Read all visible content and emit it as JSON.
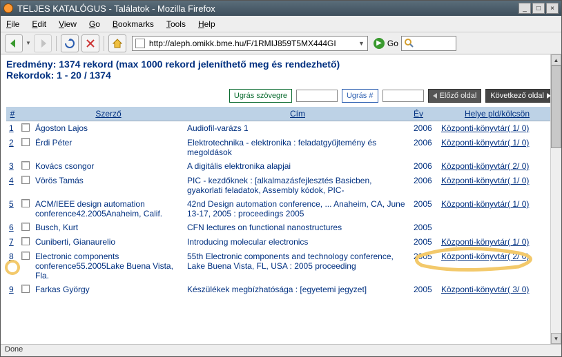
{
  "window": {
    "title": "TELJES KATALÓGUS - Találatok - Mozilla Firefox"
  },
  "menu": {
    "file": "File",
    "edit": "Edit",
    "view": "View",
    "go": "Go",
    "bookmarks": "Bookmarks",
    "tools": "Tools",
    "help": "Help"
  },
  "toolbar": {
    "url": "http://aleph.omikk.bme.hu/F/1RMIJ859T5MX444GI",
    "go": "Go"
  },
  "summary": {
    "result_line": "Eredmény: 1374 rekord (max 1000 rekord jeleníthető meg és rendezhető)",
    "records_line": "Rekordok: 1 - 20 / 1374"
  },
  "controls": {
    "jump_text": "Ugrás szövegre",
    "jump_num": "Ugrás #",
    "prev": "Előző oldal",
    "next": "Következő oldal"
  },
  "headers": {
    "num": "#",
    "author": "Szerző",
    "title": "Cím",
    "year": "Év",
    "loc": "Helye pld/kölcsön"
  },
  "rows": [
    {
      "n": "1",
      "author": "Ágoston Lajos",
      "title": "Audiofil-varázs 1",
      "year": "2006",
      "loc": "Központi-könyvtár( 1/ 0)"
    },
    {
      "n": "2",
      "author": "Érdi Péter",
      "title": "Elektrotechnika - elektronika : feladatgyűjtemény és megoldások",
      "year": "2006",
      "loc": "Központi-könyvtár( 1/ 0)"
    },
    {
      "n": "3",
      "author": "Kovács csongor",
      "title": "A digitális elektronika alapjai",
      "year": "2006",
      "loc": "Központi-könyvtár( 2/ 0)"
    },
    {
      "n": "4",
      "author": "Vörös Tamás",
      "title": "PIC - kezdőknek : [alkalmazásfejlesztés Basicben, gyakorlati feladatok, Assembly kódok, PIC-",
      "year": "2006",
      "loc": "Központi-könyvtár( 1/ 0)"
    },
    {
      "n": "5",
      "author": "ACM/IEEE design automation conference42.2005Anaheim, Calif.",
      "title": "42nd Design automation conference, ... Anaheim, CA, June 13-17, 2005 : proceedings 2005",
      "year": "2005",
      "loc": "Központi-könyvtár( 1/ 0)"
    },
    {
      "n": "6",
      "author": "Busch, Kurt",
      "title": "CFN lectures on functional nanostructures",
      "year": "2005",
      "loc": ""
    },
    {
      "n": "7",
      "author": "Cuniberti, Gianaurelio",
      "title": "Introducing molecular electronics",
      "year": "2005",
      "loc": "Központi-könyvtár( 1/ 0)"
    },
    {
      "n": "8",
      "author": "Electronic components conference55.2005Lake Buena Vista, Fla.",
      "title": "55th Electronic components and technology conference, Lake Buena Vista, FL, USA : 2005 proceeding",
      "year": "2005",
      "loc": "Központi-könyvtár( 2/ 0)"
    },
    {
      "n": "9",
      "author": "Farkas György",
      "title": "Készülékek megbízhatósága : [egyetemi jegyzet]",
      "year": "2005",
      "loc": "Központi-könyvtár( 3/ 0)"
    }
  ],
  "status": {
    "text": "Done"
  }
}
